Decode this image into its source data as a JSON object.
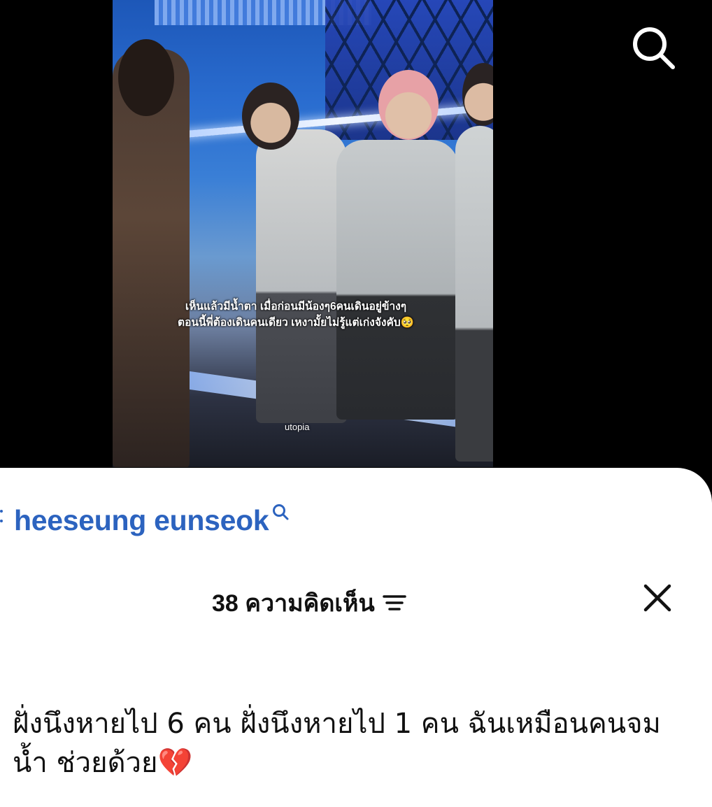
{
  "video": {
    "caption_line1": "เห็นแล้วมีน้ำตา เมื่อก่อนมีน้องๆ6คนเดินอยู่ข้างๆ",
    "caption_line2": "ตอนนี้พี่ต้องเดินคนเดียว เหงามั้ยไม่รู้แต่เก่งจังคับ🥺",
    "watermark": "utopia"
  },
  "top_bar": {
    "search_icon": "search-icon"
  },
  "comments_sheet": {
    "search_suggestion": {
      "label": "heeseung eunseok",
      "icon": "search-icon"
    },
    "header": {
      "count_label": "38 ความคิดเห็น",
      "sort_icon": "sort-icon",
      "close_icon": "close-icon"
    },
    "comments": [
      {
        "text": "ฝั่งนึงหายไป 6 คน ฝั่งนึงหายไป 1 คน ฉันเหมือนคนจมน้ำ ช่วยด้วย💔"
      }
    ]
  }
}
